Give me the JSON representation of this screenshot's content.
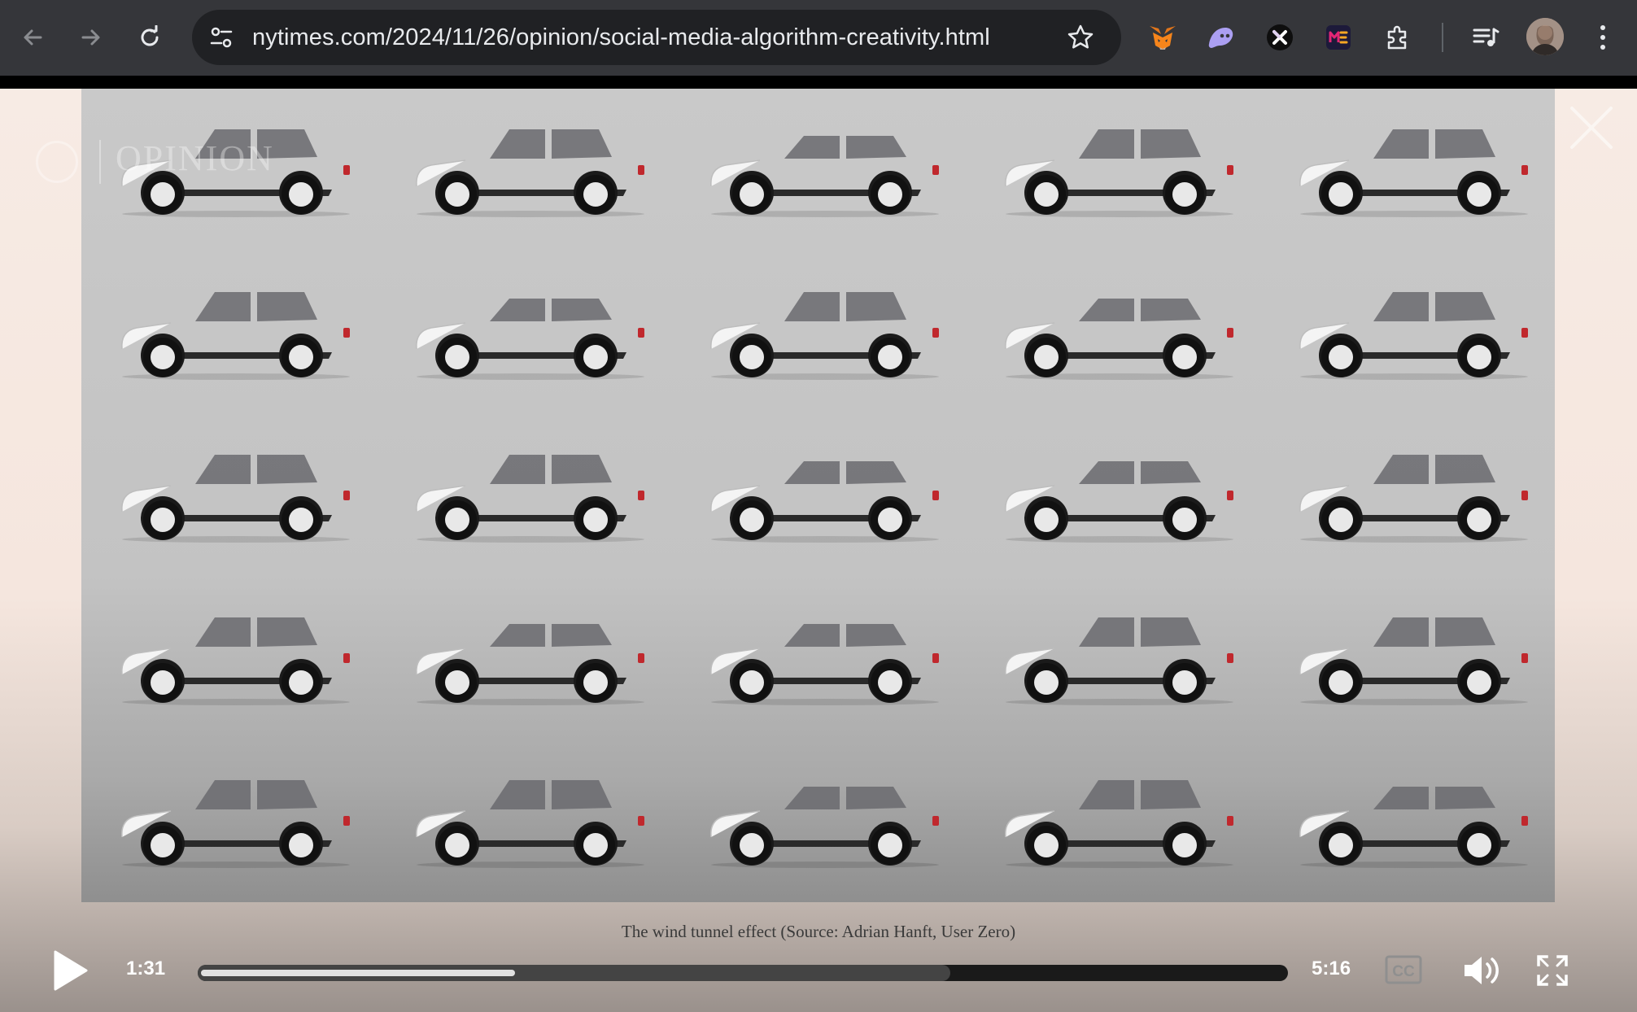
{
  "browser": {
    "url": "nytimes.com/2024/11/26/opinion/social-media-algorithm-creativity.html",
    "buttons": {
      "back": "back-icon",
      "forward": "forward-icon",
      "reload": "reload-icon",
      "site_info": "tune-icon",
      "bookmark": "star-icon",
      "extensions": "puzzle-icon",
      "media": "playlist-icon",
      "profile": "avatar",
      "menu": "kebab-icon"
    },
    "extension_icons": [
      "metamask-fox-icon",
      "ghost-extension-icon",
      "x-extension-icon",
      "magic-eden-icon"
    ]
  },
  "video": {
    "watermark": "OPINION",
    "caption": "The wind tunnel effect (Source: Adrian Hanft, User Zero)",
    "grid": {
      "rows": 5,
      "cols": 5
    },
    "cars": [
      {
        "style": "suv",
        "roof": "boxy"
      },
      {
        "style": "suv",
        "roof": "long"
      },
      {
        "style": "crossover",
        "roof": "slope"
      },
      {
        "style": "suv",
        "roof": "boxy"
      },
      {
        "style": "suv",
        "roof": "long"
      },
      {
        "style": "suv",
        "roof": "boxy"
      },
      {
        "style": "crossover",
        "roof": "slope"
      },
      {
        "style": "suv",
        "roof": "boxy"
      },
      {
        "style": "crossover",
        "roof": "long"
      },
      {
        "style": "suv",
        "roof": "long"
      },
      {
        "style": "suv",
        "roof": "slope"
      },
      {
        "style": "suv",
        "roof": "boxy"
      },
      {
        "style": "crossover",
        "roof": "slope"
      },
      {
        "style": "crossover",
        "roof": "slope"
      },
      {
        "style": "suv",
        "roof": "boxy"
      },
      {
        "style": "suv",
        "roof": "boxy"
      },
      {
        "style": "crossover",
        "roof": "slope"
      },
      {
        "style": "crossover",
        "roof": "slope"
      },
      {
        "style": "suv",
        "roof": "boxy"
      },
      {
        "style": "suv",
        "roof": "boxy"
      },
      {
        "style": "suv",
        "roof": "boxy"
      },
      {
        "style": "suv",
        "roof": "boxy"
      },
      {
        "style": "crossover",
        "roof": "slope"
      },
      {
        "style": "suv",
        "roof": "boxy"
      },
      {
        "style": "crossover",
        "roof": "long"
      }
    ]
  },
  "player": {
    "current_time": "1:31",
    "duration": "5:16",
    "played_fraction": 0.288,
    "buffered_fraction": 0.69,
    "cc_label": "CC",
    "icons": [
      "play-icon",
      "captions-icon",
      "volume-icon",
      "fullscreen-icon",
      "close-icon"
    ]
  },
  "colors": {
    "chrome_bg": "#35363a",
    "omnibox_bg": "#202124",
    "frame_bg": "#c6c6c6",
    "car_body": "#f4f4f4",
    "tyre": "#111111"
  }
}
